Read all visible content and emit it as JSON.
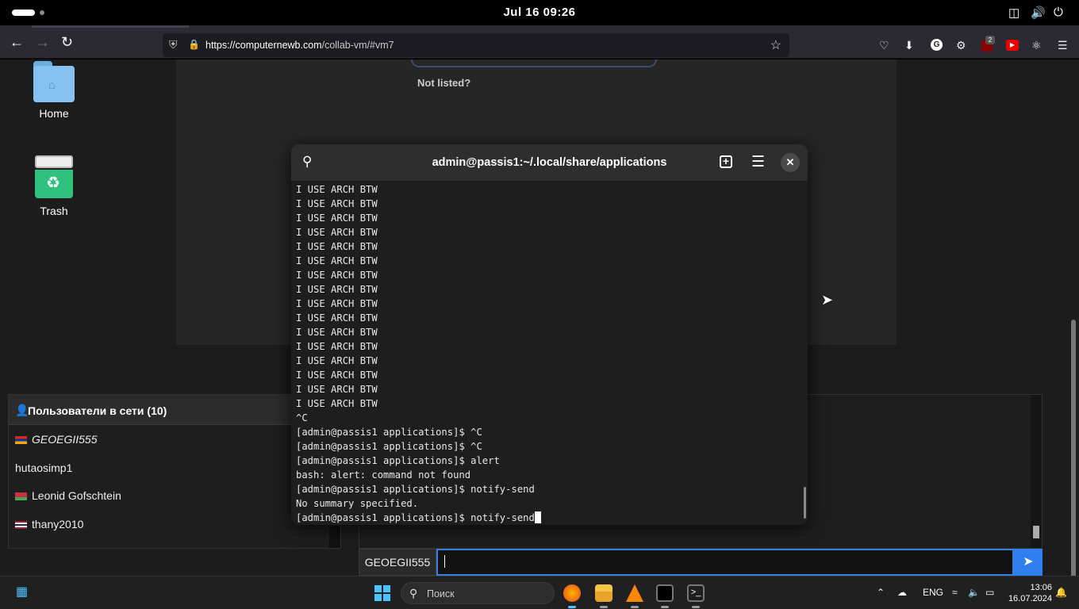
{
  "topbar": {
    "clock": "Jul 16  09:26",
    "icons": [
      "network-icon",
      "volume-icon",
      "power-icon"
    ]
  },
  "browser": {
    "url_host": "https://computernewb.com",
    "url_path": "/collab-vm/#vm7",
    "extension_badge": "2"
  },
  "vm": {
    "not_listed": "Not listed?"
  },
  "desktop": {
    "icons": [
      {
        "label": "Home"
      },
      {
        "label": "Trash"
      }
    ]
  },
  "terminal": {
    "title": "admin@passis1:~/.local/share/applications",
    "lines": [
      "I USE ARCH BTW",
      "I USE ARCH BTW",
      "I USE ARCH BTW",
      "I USE ARCH BTW",
      "I USE ARCH BTW",
      "I USE ARCH BTW",
      "I USE ARCH BTW",
      "I USE ARCH BTW",
      "I USE ARCH BTW",
      "I USE ARCH BTW",
      "I USE ARCH BTW",
      "I USE ARCH BTW",
      "I USE ARCH BTW",
      "I USE ARCH BTW",
      "I USE ARCH BTW",
      "I USE ARCH BTW",
      "^C",
      "[admin@passis1 applications]$ ^C",
      "[admin@passis1 applications]$ ^C",
      "[admin@passis1 applications]$ alert",
      "bash: alert: command not found",
      "[admin@passis1 applications]$ notify-send",
      "No summary specified.",
      "[admin@passis1 applications]$ notify-send"
    ]
  },
  "users_panel": {
    "header": "Пользователи в сети (10)",
    "users": [
      {
        "name": "GEOEGII555",
        "italic": true,
        "flag": [
          "#d52b1e",
          "#0033a0",
          "#f2a800"
        ]
      },
      {
        "name": "hutaosimp1",
        "italic": false,
        "flag": null
      },
      {
        "name": "Leonid Gofschtein",
        "italic": false,
        "flag": [
          "#c8313e",
          "#4aa657",
          "#c8313e"
        ]
      },
      {
        "name": "thany2010",
        "italic": false,
        "flag": [
          "#a51931",
          "#f4f5f8",
          "#2d2a4a"
        ]
      }
    ]
  },
  "chat": {
    "username": "GEOEGII555",
    "input_value": "",
    "send_icon": "paper-plane-icon"
  },
  "taskbar": {
    "search_label": "Поиск",
    "language": "ENG",
    "time": "13:06",
    "date": "16.07.2024"
  }
}
